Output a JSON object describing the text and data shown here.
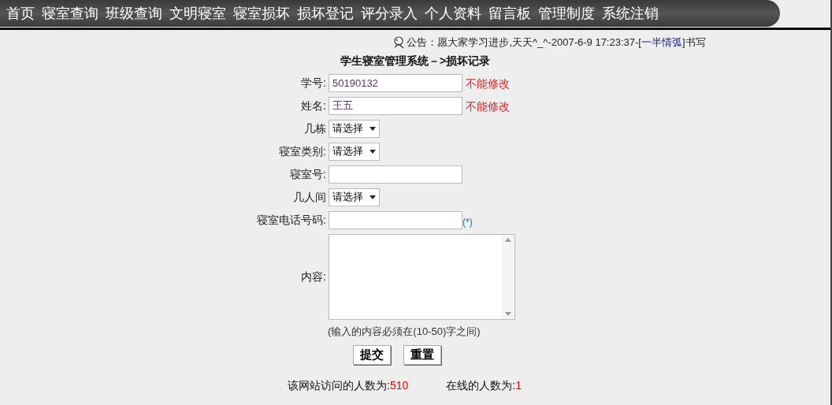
{
  "nav": [
    "首页",
    "寝室查询",
    "班级查询",
    "文明寝室",
    "寝室损坏",
    "损坏登记",
    "评分录入",
    "个人资料",
    "留言板",
    "管理制度",
    "系统注销"
  ],
  "notice": {
    "prefix": "公告：愿大家学习进步,天天^_^-2007-6-9 17:23:37-[",
    "link": "一半情弧",
    "suffix": "]书写"
  },
  "title": "学生寝室管理系统－>损坏记录",
  "fields": [
    {
      "kind": "text",
      "label": "学号:",
      "value": "50190132",
      "note": "不能修改"
    },
    {
      "kind": "text",
      "label": "姓名:",
      "value": "王五",
      "note": "不能修改"
    },
    {
      "kind": "select",
      "label": "几栋",
      "value": "请选择"
    },
    {
      "kind": "select",
      "label": "寝室类别:",
      "value": "请选择"
    },
    {
      "kind": "text",
      "label": "寝室号:"
    },
    {
      "kind": "select",
      "label": "几人间",
      "value": "请选择"
    },
    {
      "kind": "text",
      "label": "寝室电话号码:",
      "hint": "(*)"
    },
    {
      "kind": "textarea",
      "label": "内容:"
    }
  ],
  "length_hint": "(输入的内容必须在(10-50)字之间)",
  "buttons": [
    "提交",
    "重置"
  ],
  "footer": [
    {
      "label": "该网站访问的人数为:",
      "count": "510"
    },
    {
      "label": "在线的人数为:",
      "count": "1"
    }
  ]
}
